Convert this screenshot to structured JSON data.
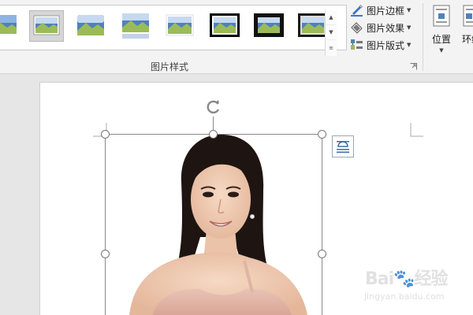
{
  "ribbon": {
    "picture_styles": {
      "group_label": "图片样式",
      "styles_count": 8,
      "selected_index": 1
    },
    "options": [
      {
        "label": "图片边框",
        "icon": "pencil-border-icon"
      },
      {
        "label": "图片效果",
        "icon": "effects-icon"
      },
      {
        "label": "图片版式",
        "icon": "picture-layout-icon"
      }
    ],
    "arrange": {
      "position_label": "位置",
      "wrap_label": "环绕"
    }
  },
  "watermark": {
    "brand": "Bai🐾经验",
    "url": "jingyan.baidu.com"
  }
}
